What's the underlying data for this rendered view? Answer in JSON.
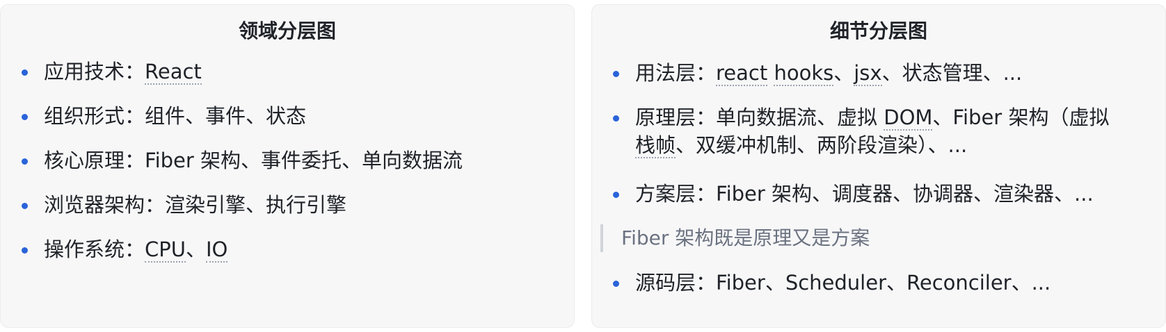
{
  "left_card": {
    "title": "领域分层图",
    "items": [
      {
        "label": "应用技术：",
        "parts": [
          "React"
        ]
      },
      {
        "label": "组织形式：",
        "text": "组件、事件、状态"
      },
      {
        "label": "核心原理：",
        "text": "Fiber 架构、事件委托、单向数据流"
      },
      {
        "label": "浏览器架构：",
        "text": "渲染引擎、执行引擎"
      },
      {
        "label": "操作系统：",
        "parts": [
          "CPU",
          "、",
          "IO"
        ]
      }
    ]
  },
  "right_card": {
    "title": "细节分层图",
    "item1": {
      "label": "用法层：",
      "a": "react",
      "b": "hooks",
      "c": "、",
      "d": "jsx",
      "e": "、状态管理、..."
    },
    "item2": {
      "label": "原理层：",
      "a": "单向数据流、虚拟 ",
      "b": "DOM",
      "c": "、Fiber 架构（虚拟",
      "d": "栈帧",
      "e": "、双缓冲机制、两阶段渲染）、..."
    },
    "item3": {
      "label": "方案层：",
      "text": "Fiber 架构、调度器、协调器、渲染器、..."
    },
    "quote": "Fiber 架构既是原理又是方案",
    "item4": {
      "label": "源码层：",
      "text": "Fiber、Scheduler、Reconciler、..."
    }
  }
}
